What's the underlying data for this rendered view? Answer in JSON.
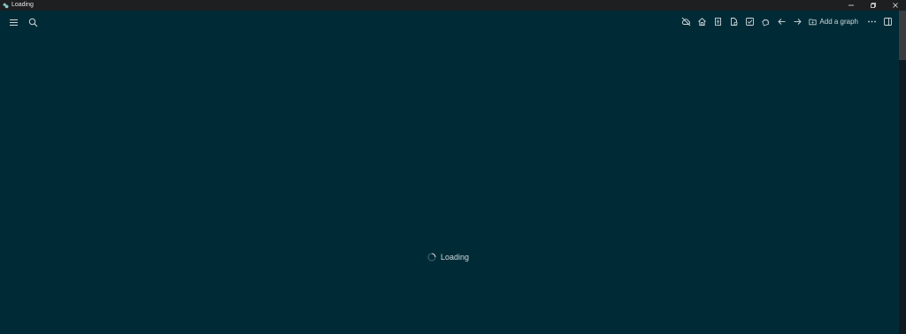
{
  "window": {
    "title": "Loading",
    "controls": [
      "minimize-icon",
      "restore-icon",
      "close-icon"
    ]
  },
  "toolbar": {
    "left_icons": [
      "menu-icon",
      "search-icon"
    ],
    "right_icons": [
      "cloud-off-icon",
      "home-icon",
      "journals-icon",
      "file-icon",
      "task-icon",
      "puzzle-icon",
      "back-icon",
      "forward-icon"
    ],
    "add_graph_label": "Add a graph",
    "more_icon": "more-icon",
    "sidebar_toggle_icon": "sidebar-icon"
  },
  "main": {
    "loading_text": "Loading"
  },
  "colors": {
    "background": "#002b36",
    "titlebar": "#1d1f20",
    "icon": "#cfd8dc",
    "text": "#cfd8dc"
  }
}
